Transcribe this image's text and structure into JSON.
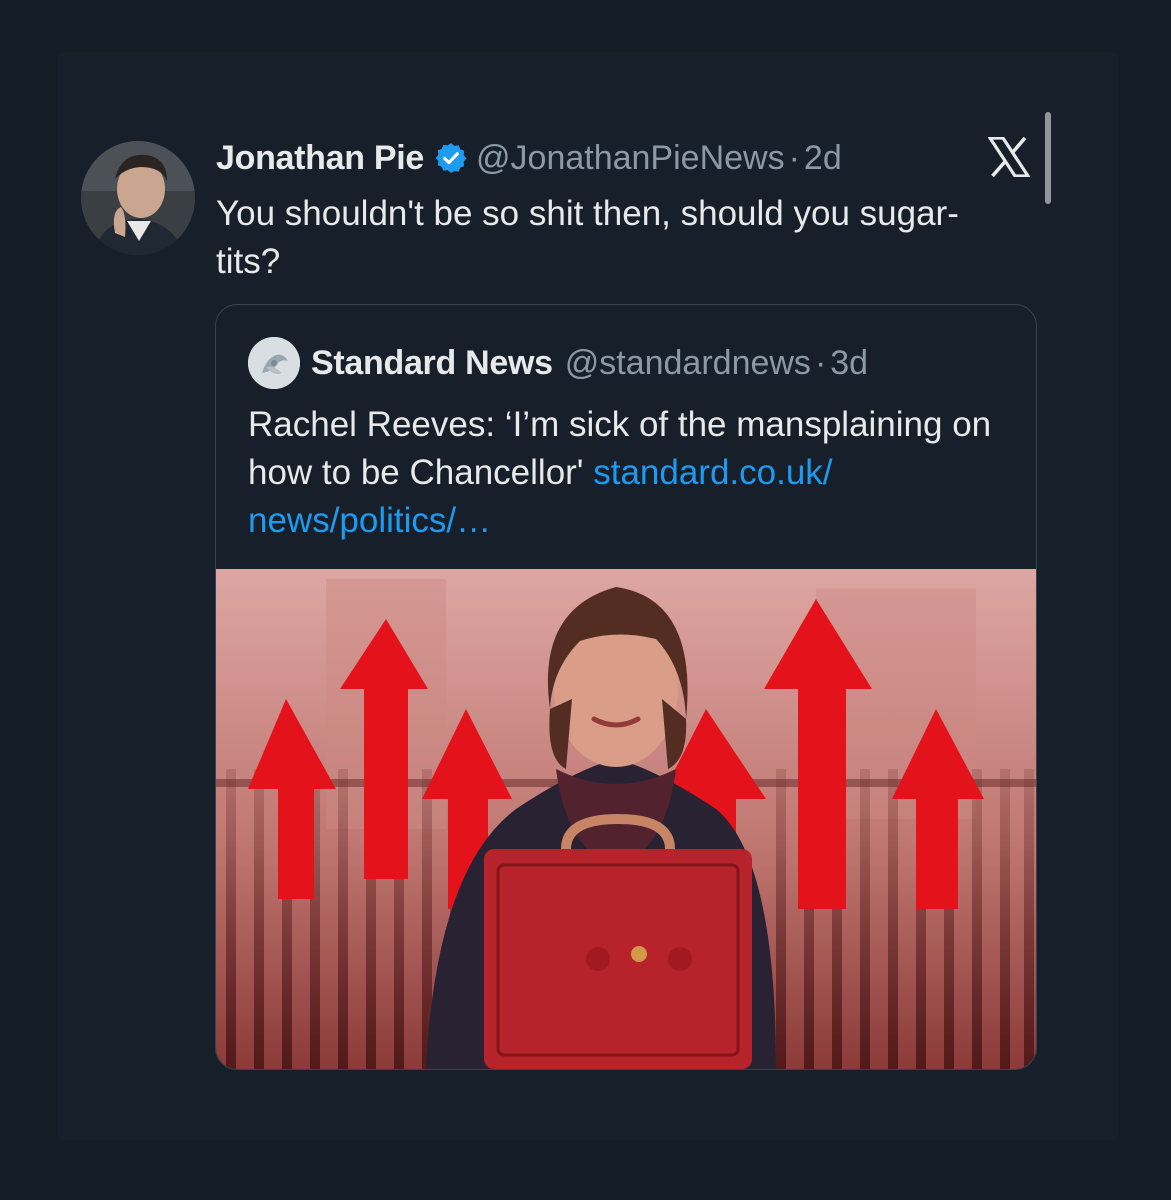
{
  "tweet": {
    "author_name": "Jonathan Pie",
    "handle": "@JonathanPieNews",
    "separator": "·",
    "time": "2d",
    "text": "You shouldn't be so shit then, should you sugar-\ntits?",
    "verified_color": "#1d9bf0"
  },
  "quoted": {
    "author_name": "Standard News",
    "handle": "@standardnews",
    "separator": "·",
    "time": "3d",
    "text": "Rachel Reeves: ‘I’m sick of the mansplaining on how to be Chancellor' ",
    "link_text": "standard.co.uk/​news/politics/…",
    "link_color": "#1d9bf0",
    "image_icons": [
      "red-arrow-icon",
      "red-box"
    ]
  },
  "colors": {
    "background": "#141c25",
    "card": "#17202a",
    "text": "#e7e9ea",
    "muted": "#8b98a5",
    "accent_red": "#e3121b"
  }
}
